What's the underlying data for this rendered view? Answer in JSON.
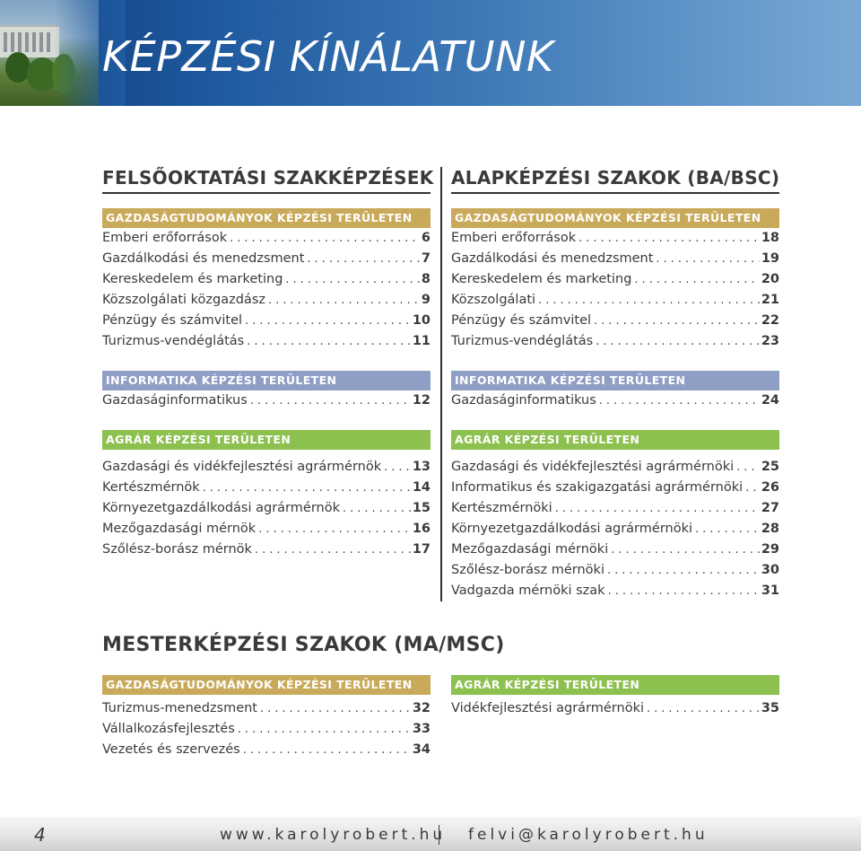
{
  "header": {
    "title": "KÉPZÉSI KÍNÁLATUNK"
  },
  "left": {
    "title": "FELSŐOKTATÁSI SZAKKÉPZÉSEK",
    "groups": [
      {
        "category": "GAZDASÁGTUDOMÁNYOK KÉPZÉSI TERÜLETEN",
        "items": [
          {
            "name": "Emberi erőforrások",
            "page": "6"
          },
          {
            "name": "Gazdálkodási és menedzsment",
            "page": "7"
          },
          {
            "name": "Kereskedelem és marketing",
            "page": "8"
          },
          {
            "name": "Közszolgálati közgazdász",
            "page": "9"
          },
          {
            "name": "Pénzügy és számvitel",
            "page": "10"
          },
          {
            "name": "Turizmus-vendéglátás",
            "page": "11"
          }
        ]
      },
      {
        "category": "INFORMATIKA KÉPZÉSI TERÜLETEN",
        "items": [
          {
            "name": "Gazdaságinformatikus",
            "page": "12"
          }
        ]
      },
      {
        "category": "AGRÁR KÉPZÉSI TERÜLETEN",
        "items": [
          {
            "name": "Gazdasági és vidékfejlesztési agrármérnök",
            "page": "13"
          },
          {
            "name": "Kertészmérnök",
            "page": "14"
          },
          {
            "name": "Környezetgazdálkodási agrármérnök",
            "page": "15"
          },
          {
            "name": "Mezőgazdasági mérnök",
            "page": "16"
          },
          {
            "name": "Szőlész-borász mérnök",
            "page": "17"
          }
        ]
      }
    ]
  },
  "right": {
    "title": "ALAPKÉPZÉSI SZAKOK (BA/BSC)",
    "groups": [
      {
        "category": "GAZDASÁGTUDOMÁNYOK KÉPZÉSI TERÜLETEN",
        "items": [
          {
            "name": "Emberi erőforrások",
            "page": "18"
          },
          {
            "name": "Gazdálkodási és menedzsment",
            "page": "19"
          },
          {
            "name": "Kereskedelem és marketing",
            "page": "20"
          },
          {
            "name": "Közszolgálati",
            "page": "21"
          },
          {
            "name": "Pénzügy és számvitel",
            "page": "22"
          },
          {
            "name": "Turizmus-vendéglátás",
            "page": "23"
          }
        ]
      },
      {
        "category": "INFORMATIKA KÉPZÉSI TERÜLETEN",
        "items": [
          {
            "name": "Gazdaságinformatikus",
            "page": "24"
          }
        ]
      },
      {
        "category": "AGRÁR KÉPZÉSI TERÜLETEN",
        "items": [
          {
            "name": "Gazdasági és vidékfejlesztési agrármérnöki",
            "page": "25"
          },
          {
            "name": "Informatikus és szakigazgatási agrármérnöki",
            "page": "26"
          },
          {
            "name": "Kertészmérnöki",
            "page": "27"
          },
          {
            "name": "Környezetgazdálkodási agrármérnöki",
            "page": "28"
          },
          {
            "name": "Mezőgazdasági mérnöki",
            "page": "29"
          },
          {
            "name": "Szőlész-borász mérnöki",
            "page": "30"
          },
          {
            "name": "Vadgazda mérnöki szak",
            "page": "31"
          }
        ]
      }
    ]
  },
  "msc": {
    "title": "MESTERKÉPZÉSI SZAKOK (MA/MSC)",
    "left": {
      "category": "GAZDASÁGTUDOMÁNYOK KÉPZÉSI TERÜLETEN",
      "items": [
        {
          "name": "Turizmus-menedzsment",
          "page": "32"
        },
        {
          "name": "Vállalkozásfejlesztés",
          "page": "33"
        },
        {
          "name": "Vezetés és szervezés",
          "page": "34"
        }
      ]
    },
    "right": {
      "category": "AGRÁR KÉPZÉSI TERÜLETEN",
      "items": [
        {
          "name": "Vidékfejlesztési agrármérnöki",
          "page": "35"
        }
      ]
    }
  },
  "footer": {
    "page_number": "4",
    "website": "www.karolyrobert.hu",
    "email": "felvi@karolyrobert.hu"
  },
  "colors": {
    "banner_blue": "#1f5a9f",
    "cat_gazdasag": "#c9a95a",
    "cat_informatika": "#8f9ec4",
    "cat_agrar": "#8cc04f"
  }
}
